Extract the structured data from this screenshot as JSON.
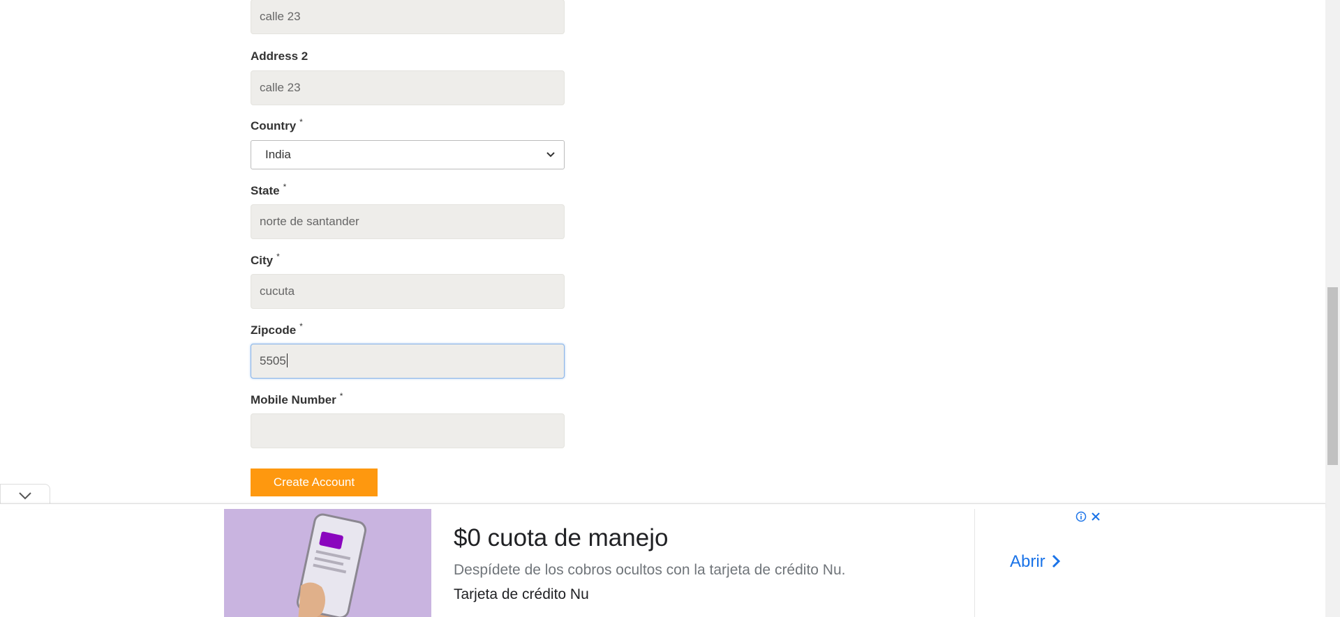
{
  "form": {
    "address1": {
      "value": "calle 23"
    },
    "address2": {
      "label": "Address 2",
      "value": "calle 23"
    },
    "country": {
      "label": "Country",
      "required": "*",
      "selected": "India"
    },
    "state": {
      "label": "State",
      "required": "*",
      "value": "norte de santander"
    },
    "city": {
      "label": "City",
      "required": "*",
      "value": "cucuta"
    },
    "zipcode": {
      "label": "Zipcode",
      "required": "*",
      "value": "5505"
    },
    "mobile": {
      "label": "Mobile Number",
      "required": "*",
      "value": ""
    },
    "submit_label": "Create Account"
  },
  "ad": {
    "title": "$0 cuota de manejo",
    "description": "Despídete de los cobros ocultos con la tarjeta de crédito Nu.",
    "brand": "Tarjeta de crédito Nu",
    "cta": "Abrir"
  },
  "colors": {
    "button": "#fe980f",
    "input_bg": "#eeedea",
    "ad_link": "#1a73e8",
    "ad_image_bg": "#c9b4e0",
    "card_purple": "#8a05be"
  },
  "icons": [
    "chevron-down-icon",
    "collapse-chevron-icon",
    "ad-info-icon",
    "ad-close-icon",
    "chevron-right-icon"
  ]
}
